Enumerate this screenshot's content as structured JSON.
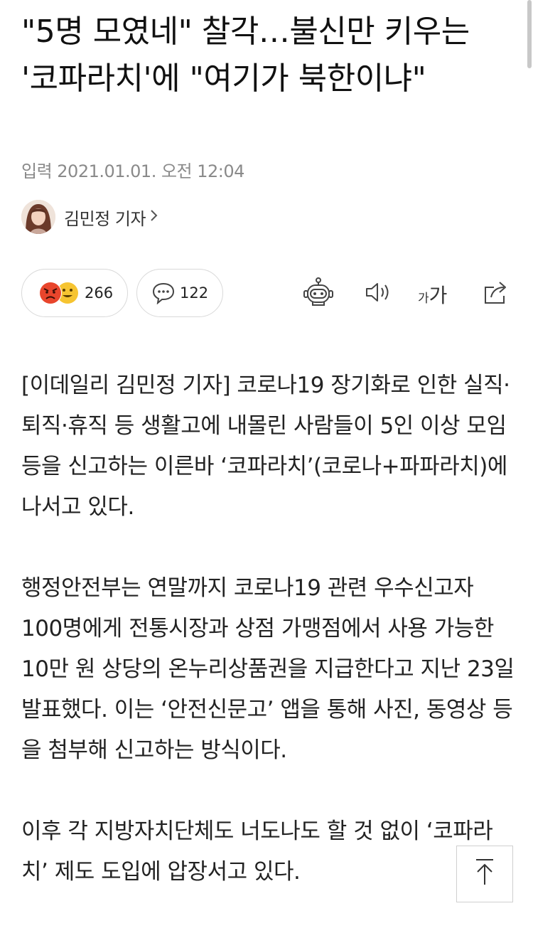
{
  "article": {
    "headline": "\"5명 모였네\" 찰각…불신만 키우는 '코파라치'에 \"여기가 북한이냐\"",
    "published": "입력 2021.01.01. 오전 12:04",
    "author": "김민정 기자"
  },
  "reactions": {
    "count": "266",
    "comment_count": "122"
  },
  "toolbar": {
    "font_small": "가",
    "font_large": "가"
  },
  "body": {
    "p1": "[이데일리 김민정 기자] 코로나19 장기화로 인한 실직·퇴직·휴직 등 생활고에 내몰린 사람들이 5인 이상 모임 등을 신고하는 이른바 ‘코파라치’(코로나+파파라치)에 나서고 있다.",
    "p2": "행정안전부는 연말까지 코로나19 관련 우수신고자 100명에게 전통시장과 상점 가맹점에서 사용 가능한 10만 원 상당의 온누리상품권을 지급한다고 지난 23일 발표했다. 이는 ‘안전신문고’ 앱을 통해 사진, 동영상 등을 첨부해 신고하는 방식이다.",
    "p3": "이후 각 지방자치단체도 너도나도 할 것 없이 ‘코파라치’ 제도 도입에 압장서고 있다."
  },
  "icons": {
    "angry": "angry-face-icon",
    "smile": "smiling-face-icon",
    "comment": "speech-bubble-icon",
    "summary": "robot-icon",
    "audio": "speaker-icon",
    "share": "share-icon",
    "top": "arrow-up-icon"
  },
  "colors": {
    "angry_face": "#e8452c",
    "smile_face": "#f6c431",
    "meta_text": "#8a8a8a",
    "border": "#d9d9d9"
  }
}
